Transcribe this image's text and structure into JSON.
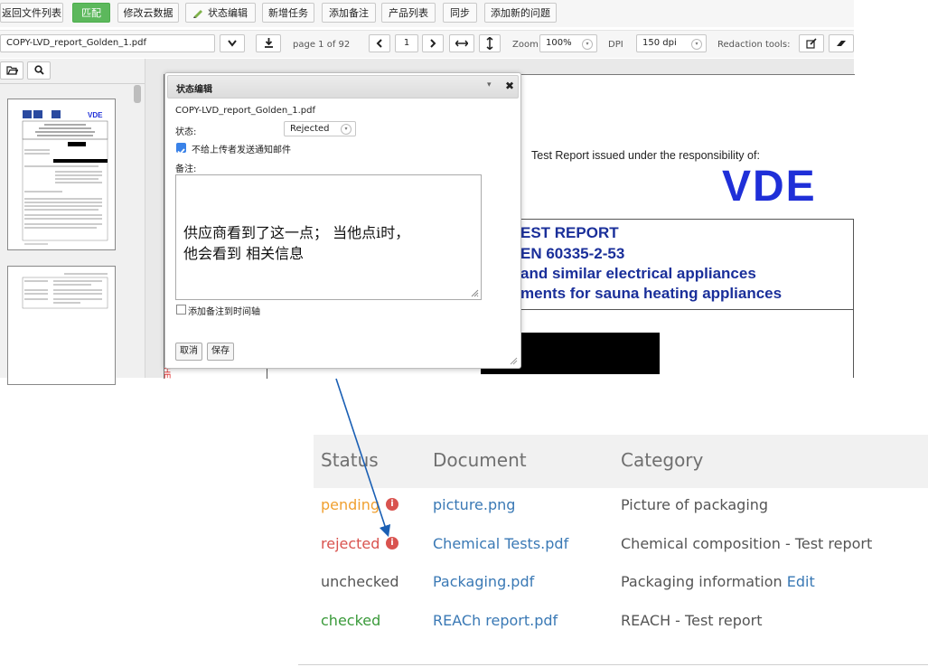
{
  "toolbar": {
    "buttons": [
      "返回文件列表",
      "匹配",
      "修改云数据",
      "状态编辑",
      "新增任务",
      "添加备注",
      "产品列表",
      "同步",
      "添加新的问题"
    ]
  },
  "viewer_toolbar": {
    "filename": "COPY-LVD_report_Golden_1.pdf",
    "page_text": "page 1 of 92",
    "page_input": "1",
    "zoom_label": "Zoom",
    "zoom_value": "100%",
    "dpi_label": "DPI",
    "dpi_value": "150 dpi",
    "redaction_label": "Redaction tools:"
  },
  "pdf_page": {
    "issued_under": "Test Report issued under the responsibility of:",
    "logo": "VDE",
    "line1": "EST REPORT",
    "line2": "EN 60335-2-53",
    "line3": "and similar electrical appliances",
    "line4": "ments for sauna heating appliances",
    "margin_text": "FHE"
  },
  "dialog": {
    "title": "状态编辑",
    "filename": "COPY-LVD_report_Golden_1.pdf",
    "status_label": "状态:",
    "status_value": "Rejected",
    "checkbox_label": "不给上传者发送通知邮件",
    "notes_label": "备注:",
    "notes_text_line1": "供应商看到了这一点；  当他点i时，",
    "notes_text_line2": "他会看到 相关信息",
    "timeline_label": "添加备注到时间轴",
    "cancel": "取消",
    "save": "保存"
  },
  "table": {
    "headers": [
      "Status",
      "Document",
      "Category"
    ],
    "rows": [
      {
        "status": "pending",
        "document": "picture.png",
        "category": "Picture of packaging"
      },
      {
        "status": "rejected",
        "document": "Chemical Tests.pdf",
        "category": "Chemical composition - Test report"
      },
      {
        "status": "unchecked",
        "document": "Packaging.pdf",
        "category": "Packaging information",
        "edit": "Edit"
      },
      {
        "status": "checked",
        "document": "REACh report.pdf",
        "category": "REACH - Test report"
      }
    ]
  },
  "colors": {
    "pending": "#f0a030",
    "rejected": "#d9534f",
    "unchecked": "#555555",
    "checked": "#3a9a3a",
    "link": "#3a79b5",
    "vde_blue": "#1f2fd8",
    "green_button": "#5cb85c"
  }
}
